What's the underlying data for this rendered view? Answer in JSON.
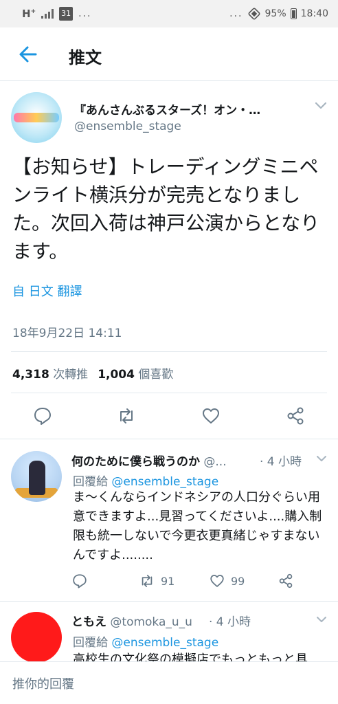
{
  "status_bar": {
    "network": "H",
    "network_sup": "+",
    "calendar_day": "31",
    "dots": "...",
    "dots_right": "...",
    "battery": "95%",
    "time": "18:40"
  },
  "header": {
    "title": "推文",
    "back_icon": "arrow-left-icon"
  },
  "tweet": {
    "display_name": "『あんさんぶるスターズ！オン・…",
    "handle": "@ensemble_stage",
    "text": "【お知らせ】トレーディングミニペンライト横浜分が完売となりました。次回入荷は神戸公演からとなります。",
    "translate": "自 日文 翻譯",
    "timestamp": "18年9月22日 14:11",
    "retweet_count": "4,318",
    "retweet_label": "次轉推",
    "like_count": "1,004",
    "like_label": "個喜歡"
  },
  "replies": [
    {
      "name": "何のために僕ら戦うのか",
      "handle": "@...",
      "time": "· 4 小時",
      "reply_prefix": "回覆給",
      "reply_to": "@ensemble_stage",
      "text": "ま〜くんならインドネシアの人口分ぐらい用意できますよ...見習ってくださいよ....購入制限も統一しないで今更衣更真緒じゃすまないんですよ........",
      "retweets": "91",
      "likes": "99"
    },
    {
      "name": "ともえ",
      "handle": "@tomoka_u_u",
      "time": "· 4 小時",
      "reply_prefix": "回覆給",
      "reply_to": "@ensemble_stage",
      "text": "高校生の文化祭の模擬店でもっともっと具"
    }
  ],
  "compose": {
    "placeholder": "推你的回覆"
  },
  "colors": {
    "accent": "#1b95e0",
    "secondary_text": "#657786",
    "divider": "#e1e8ed"
  }
}
